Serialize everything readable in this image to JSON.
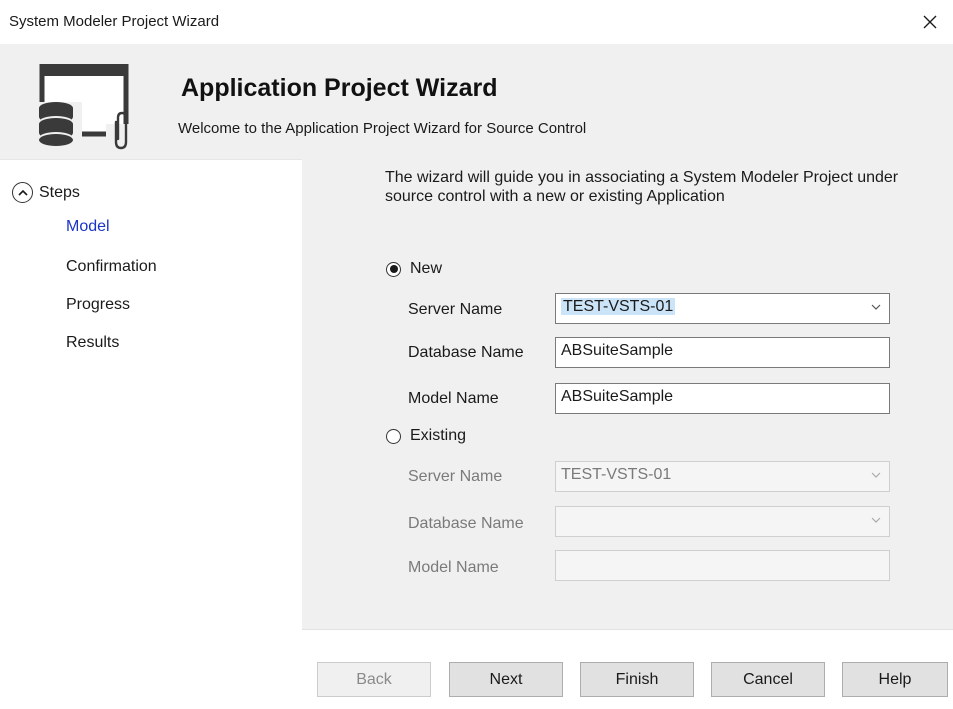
{
  "window": {
    "title": "System Modeler Project Wizard"
  },
  "header": {
    "title": "Application Project Wizard",
    "subtitle": "Welcome to the Application Project Wizard for Source Control"
  },
  "sidebar": {
    "heading": "Steps",
    "items": [
      {
        "label": "Model",
        "active": true
      },
      {
        "label": "Confirmation",
        "active": false
      },
      {
        "label": "Progress",
        "active": false
      },
      {
        "label": "Results",
        "active": false
      }
    ]
  },
  "main": {
    "intro": "The wizard will guide you in associating a System Modeler Project under source control with a new or existing Application",
    "new_option": {
      "label": "New",
      "selected": true,
      "server_label": "Server Name",
      "server_value": "TEST-VSTS-01",
      "database_label": "Database Name",
      "database_value": "ABSuiteSample",
      "model_label": "Model Name",
      "model_value": "ABSuiteSample"
    },
    "existing_option": {
      "label": "Existing",
      "selected": false,
      "server_label": "Server Name",
      "server_value": "TEST-VSTS-01",
      "database_label": "Database Name",
      "database_value": "",
      "model_label": "Model Name",
      "model_value": ""
    }
  },
  "buttons": {
    "back": "Back",
    "next": "Next",
    "finish": "Finish",
    "cancel": "Cancel",
    "help": "Help"
  },
  "colors": {
    "active_step": "#1a33c8",
    "selection_highlight": "#cce4f7",
    "panel_background": "#f0f0f0"
  }
}
